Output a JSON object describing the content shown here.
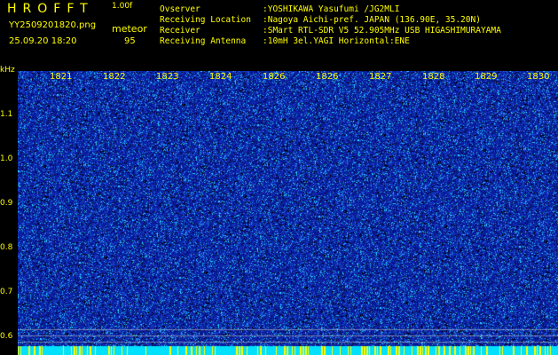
{
  "header": {
    "brand": "HROFFT",
    "version": "1.00f",
    "filename": "YY2509201820.png",
    "datetime": "25.09.20 18:20",
    "meteor_label": "meteor",
    "meteor_count": "95"
  },
  "info": [
    {
      "label": "Ovserver",
      "value": ":YOSHIKAWA Yasufumi /JG2MLI"
    },
    {
      "label": "Receiving Location",
      "value": ":Nagoya Aichi-pref. JAPAN (136.90E, 35.20N)"
    },
    {
      "label": "Receiver",
      "value": ":SMart RTL-SDR V5 52.905MHz USB HIGASHIMURAYAMA"
    },
    {
      "label": "Receiving Antenna",
      "value": ":10mH 3el.YAGI Horizontal:ENE"
    }
  ],
  "spectrogram": {
    "y_unit": "kHz",
    "y_ticks": [
      "1.1",
      "1.0",
      "0.9",
      "0.8",
      "0.7",
      "0.6"
    ],
    "x_ticks": [
      "1821",
      "1822",
      "1823",
      "1824",
      "1826",
      "1826",
      "1827",
      "1828",
      "1829",
      "1830"
    ],
    "colors": {
      "background": "#0a1a9a",
      "noise": "#28d2ff",
      "bottom_bar": "#00e0ff",
      "text": "#ffff00"
    }
  }
}
